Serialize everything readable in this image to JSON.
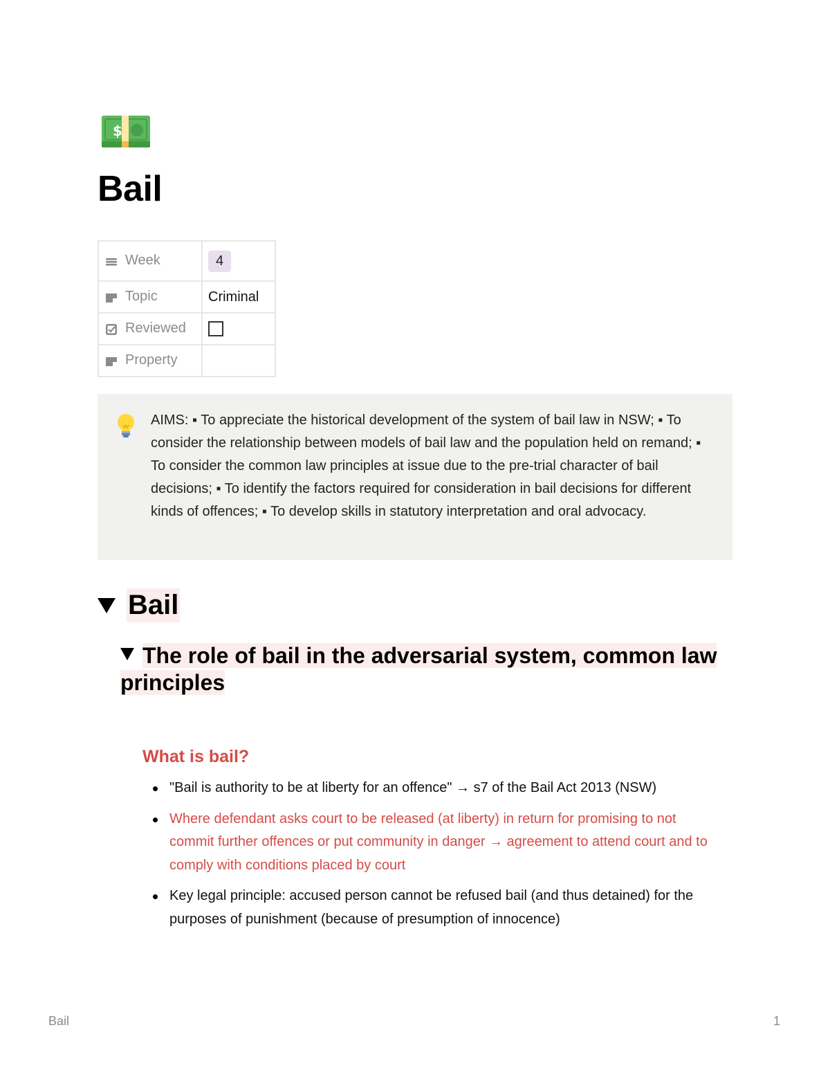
{
  "page": {
    "icon": "money-banknote-icon",
    "title": "Bail"
  },
  "properties": [
    {
      "icon": "list-icon",
      "name": "Week",
      "value": "4",
      "type": "badge",
      "badge_color": "#e8deee"
    },
    {
      "icon": "text-property-icon",
      "name": "Topic",
      "value": "Criminal",
      "type": "text"
    },
    {
      "icon": "checkbox-property-icon",
      "name": "Reviewed",
      "value": false,
      "type": "checkbox"
    },
    {
      "icon": "text-property-icon",
      "name": "Property",
      "value": "",
      "type": "text"
    }
  ],
  "callout": {
    "icon": "lightbulb-icon",
    "text": "AIMS: ▪ To appreciate the historical development of the system of bail law in NSW; ▪ To consider the relationship between models of bail law and the population held on remand; ▪ To consider the common law principles at issue due to the pre-trial character of bail decisions; ▪ To identify the factors required for consideration in bail decisions for different kinds of offences; ▪ To develop skills in statutory interpretation and oral advocacy.",
    "background": "#f1f1ef"
  },
  "toggle_h1": {
    "label": "Bail",
    "highlight": "#fdecec"
  },
  "toggle_h2": {
    "label": "The role of bail in the adversarial system, common law principles"
  },
  "section": {
    "heading": "What is bail?",
    "heading_color": "#d44c47",
    "bullets": [
      {
        "text": "\"Bail is authority to be at liberty for an offence\" → s7 of the Bail Act 2013 (NSW)",
        "color": "black"
      },
      {
        "text": "Where defendant asks court to be released (at liberty) in return for promising to not commit further offences or put community in danger → agreement to attend court and to comply with conditions placed by court",
        "color": "red"
      },
      {
        "text": "Key legal principle: accused person cannot be refused bail (and thus detained) for the purposes of punishment (because of presumption of innocence)",
        "color": "black"
      }
    ]
  },
  "footer": {
    "title": "Bail",
    "page_number": "1"
  }
}
